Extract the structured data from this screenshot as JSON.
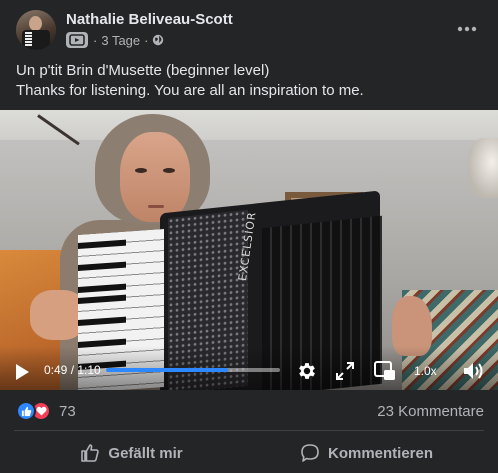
{
  "post": {
    "author": "Nathalie Beliveau-Scott",
    "time_ago": "3 Tage",
    "separator": "·",
    "text_line1": "Un p'tit Brin d'Musette (beginner level)",
    "text_line2": "Thanks for listening. You are all an inspiration to me."
  },
  "video": {
    "current_time": "0:49",
    "duration": "1:10",
    "time_display": "0:49 / 1:10",
    "progress_fraction": 0.7,
    "speed": "1.0x",
    "brand_text": "EXCELSIOR",
    "accent_color": "#2d88ff"
  },
  "reactions": {
    "count": "73",
    "types": [
      "like-icon",
      "love-icon"
    ],
    "comments_label": "23 Kommentare"
  },
  "actions": {
    "like_label": "Gefällt mir",
    "comment_label": "Kommentieren"
  },
  "icons": {
    "more": "more-options-icon",
    "audience": "globe-icon",
    "reel": "reel-icon",
    "play": "play-icon",
    "settings": "gear-icon",
    "fullscreen": "expand-icon",
    "pip": "picture-in-picture-icon",
    "volume": "volume-icon"
  },
  "colors": {
    "background": "#242526",
    "primary_text": "#e4e6eb",
    "secondary_text": "#b0b3b8",
    "like_blue": "#2d88ff",
    "love_red": "#f33e58"
  }
}
